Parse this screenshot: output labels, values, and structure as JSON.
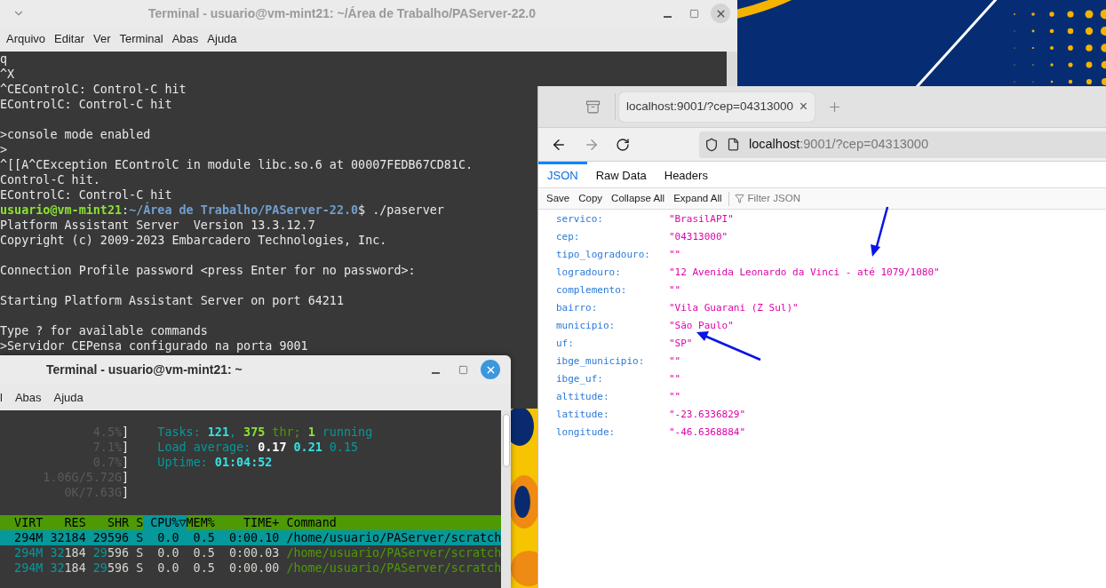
{
  "terminal_main": {
    "title": "Terminal - usuario@vm-mint21: ~/Área de Trabalho/PAServer-22.0",
    "menu": [
      "Arquivo",
      "Editar",
      "Ver",
      "Terminal",
      "Abas",
      "Ajuda"
    ],
    "lines": [
      {
        "kind": "text",
        "text": "q"
      },
      {
        "kind": "text",
        "text": "^X"
      },
      {
        "kind": "text",
        "text": "^CEControlC: Control-C hit"
      },
      {
        "kind": "text",
        "text": "EControlC: Control-C hit"
      },
      {
        "kind": "blank"
      },
      {
        "kind": "text",
        "text": ">console mode enabled"
      },
      {
        "kind": "text",
        "text": ">"
      },
      {
        "kind": "text",
        "text": "^[[A^CException EControlC in module libc.so.6 at 00007FEDB67CD81C."
      },
      {
        "kind": "text",
        "text": "Control-C hit."
      },
      {
        "kind": "text",
        "text": "EControlC: Control-C hit"
      },
      {
        "kind": "prompt",
        "user": "usuario@vm-mint21",
        "separator": ":",
        "path": "~/Área de Trabalho/PAServer-22.0",
        "command": "$ ./paserver"
      },
      {
        "kind": "text",
        "text": "Platform Assistant Server  Version 13.3.12.7"
      },
      {
        "kind": "text",
        "text": "Copyright (c) 2009-2023 Embarcadero Technologies, Inc."
      },
      {
        "kind": "blank"
      },
      {
        "kind": "text",
        "text": "Connection Profile password <press Enter for no password>:"
      },
      {
        "kind": "blank"
      },
      {
        "kind": "text",
        "text": "Starting Platform Assistant Server on port 64211"
      },
      {
        "kind": "blank"
      },
      {
        "kind": "text",
        "text": "Type ? for available commands"
      },
      {
        "kind": "text",
        "text": ">Servidor CEPensa configurado na porta 9001"
      }
    ]
  },
  "terminal_htop": {
    "title": "Terminal - usuario@vm-mint21: ~",
    "menu": [
      "l",
      "Abas",
      "Ajuda"
    ],
    "meters": [
      {
        "reading": "4.5%",
        "bracket": "]"
      },
      {
        "reading": "7.1%",
        "bracket": "]"
      },
      {
        "reading": "0.7%",
        "bracket": "]"
      },
      {
        "reading": "1.06G/5.72G",
        "bracket": "]"
      },
      {
        "reading": "0K/7.63G",
        "bracket": "]"
      }
    ],
    "info_lines": [
      {
        "segments": [
          {
            "kind": "label",
            "text": "Tasks: "
          },
          {
            "kind": "value",
            "text": "121"
          },
          {
            "kind": "label",
            "text": ", "
          },
          {
            "kind": "thread_value",
            "text": "375"
          },
          {
            "kind": "thread_label",
            "text": " thr; "
          },
          {
            "kind": "thread_value",
            "text": "1"
          },
          {
            "kind": "label",
            "text": " running"
          }
        ]
      },
      {
        "segments": [
          {
            "kind": "label",
            "text": "Load average: "
          },
          {
            "kind": "white_value",
            "text": "0.17 "
          },
          {
            "kind": "value",
            "text": "0.21 "
          },
          {
            "kind": "label",
            "text": "0.15"
          }
        ]
      },
      {
        "segments": [
          {
            "kind": "label",
            "text": "Uptime: "
          },
          {
            "kind": "value",
            "text": "01:04:52"
          }
        ]
      }
    ],
    "columns": [
      {
        "label": "VIRT",
        "selected": false
      },
      {
        "label": "RES",
        "selected": false
      },
      {
        "label": "SHR",
        "selected": false
      },
      {
        "label": "S",
        "selected": false
      },
      {
        "label": "CPU%▽",
        "selected": true
      },
      {
        "label": "MEM%",
        "selected": false
      },
      {
        "label": "TIME+",
        "selected": false
      },
      {
        "label": "Command",
        "selected": false
      }
    ],
    "processes": [
      {
        "selected": true,
        "virt": "294M",
        "res_high": "32",
        "res_low": "184",
        "shr_high": "29",
        "shr_low": "596",
        "state": "S",
        "cpu": "0.0",
        "mem": "0.5",
        "time": "0:00.10",
        "command": "/home/usuario/PAServer/scratch"
      },
      {
        "selected": false,
        "virt": "294M",
        "res_high": "32",
        "res_low": "184",
        "shr_high": "29",
        "shr_low": "596",
        "state": "S",
        "cpu": "0.0",
        "mem": "0.5",
        "time": "0:00.03",
        "command": "/home/usuario/PAServer/scratch"
      },
      {
        "selected": false,
        "virt": "294M",
        "res_high": "32",
        "res_low": "184",
        "shr_high": "29",
        "shr_low": "596",
        "state": "S",
        "cpu": "0.0",
        "mem": "0.5",
        "time": "0:00.00",
        "command": "/home/usuario/PAServer/scratch"
      }
    ]
  },
  "browser": {
    "tab": {
      "title": "localhost:9001/?cep=04313000",
      "close": "×"
    },
    "url": {
      "host": "localhost",
      "rest": ":9001/?cep=04313000"
    },
    "viewer_tabs": [
      {
        "label": "JSON",
        "selected": true
      },
      {
        "label": "Raw Data",
        "selected": false
      },
      {
        "label": "Headers",
        "selected": false
      }
    ],
    "toolbar": [
      "Save",
      "Copy",
      "Collapse All",
      "Expand All"
    ],
    "filter": {
      "placeholder": "Filter JSON"
    },
    "fields": [
      {
        "key": "servico:",
        "value": "\"BrasilAPI\""
      },
      {
        "key": "cep:",
        "value": "\"04313000\""
      },
      {
        "key": "tipo_logradouro:",
        "value": "\"\""
      },
      {
        "key": "logradouro:",
        "value": "\"12 Avenida Leonardo da Vinci - até 1079/1080\""
      },
      {
        "key": "complemento:",
        "value": "\"\""
      },
      {
        "key": "bairro:",
        "value": "\"Vila Guarani (Z Sul)\""
      },
      {
        "key": "municipio:",
        "value": "\"São Paulo\""
      },
      {
        "key": "uf:",
        "value": "\"SP\""
      },
      {
        "key": "ibge_municipio:",
        "value": "\"\""
      },
      {
        "key": "ibge_uf:",
        "value": "\"\""
      },
      {
        "key": "altitude:",
        "value": "\"\""
      },
      {
        "key": "latitude:",
        "value": "\"-23.6336829\""
      },
      {
        "key": "longitude:",
        "value": "\"-46.6368884\""
      }
    ]
  }
}
